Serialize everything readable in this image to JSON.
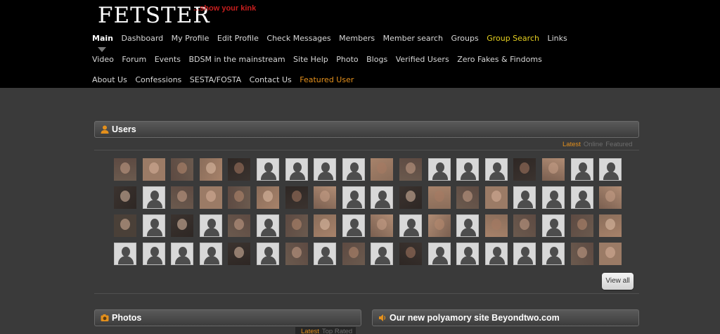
{
  "brand": {
    "logo": "FETSTER",
    "tagline": "...show your kink"
  },
  "nav": {
    "row1": [
      "Main",
      "Dashboard",
      "My Profile",
      "Edit Profile",
      "Check Messages",
      "Members",
      "Member search",
      "Groups",
      "Group Search",
      "Links"
    ],
    "row2": [
      "Video",
      "Forum",
      "Events",
      "BDSM in the mainstream",
      "Site Help",
      "Photo",
      "Blogs",
      "Verified Users",
      "Zero Fakes & Findoms"
    ],
    "row3": [
      "About Us",
      "Confessions",
      "SESTA/FOSTA",
      "Contact Us",
      "Featured User"
    ],
    "active": "Main",
    "highlight_yellow": "Group Search",
    "highlight_orange": "Featured User"
  },
  "users_panel": {
    "title": "Users",
    "icon": "user-icon",
    "tabs": [
      "Latest",
      "Online",
      "Featured"
    ],
    "active_tab": "Latest",
    "view_all": "View all",
    "avatars": [
      [
        "photo",
        "photo",
        "photo",
        "photo",
        "photo",
        "placeholder",
        "placeholder",
        "placeholder",
        "placeholder",
        "photo",
        "photo",
        "placeholder",
        "placeholder",
        "placeholder",
        "photo",
        "photo",
        "placeholder",
        "placeholder"
      ],
      [
        "photo",
        "placeholder",
        "photo",
        "photo",
        "photo",
        "photo",
        "photo",
        "photo",
        "placeholder",
        "placeholder",
        "photo",
        "photo",
        "photo",
        "photo",
        "placeholder",
        "placeholder",
        "placeholder",
        "photo"
      ],
      [
        "photo",
        "placeholder",
        "photo",
        "placeholder",
        "photo",
        "placeholder",
        "photo",
        "photo",
        "placeholder",
        "photo",
        "placeholder",
        "photo",
        "placeholder",
        "photo",
        "photo",
        "placeholder",
        "photo",
        "photo"
      ],
      [
        "placeholder",
        "placeholder",
        "placeholder",
        "placeholder",
        "photo",
        "placeholder",
        "photo",
        "placeholder",
        "photo",
        "placeholder",
        "photo",
        "placeholder",
        "placeholder",
        "placeholder",
        "placeholder",
        "placeholder",
        "photo",
        "photo"
      ]
    ]
  },
  "photos_panel": {
    "title": "Photos",
    "icon": "camera-icon",
    "tabs": [
      "Latest",
      "Top Rated"
    ],
    "active_tab": "Latest"
  },
  "promo_panel": {
    "title": "Our new polyamory site Beyondtwo.com",
    "icon": "speaker-icon"
  },
  "colors": {
    "accent_orange": "#e4901c",
    "accent_yellow": "#e5d020",
    "tagline_red": "#c81e1e",
    "background": "#3a3a3a"
  }
}
